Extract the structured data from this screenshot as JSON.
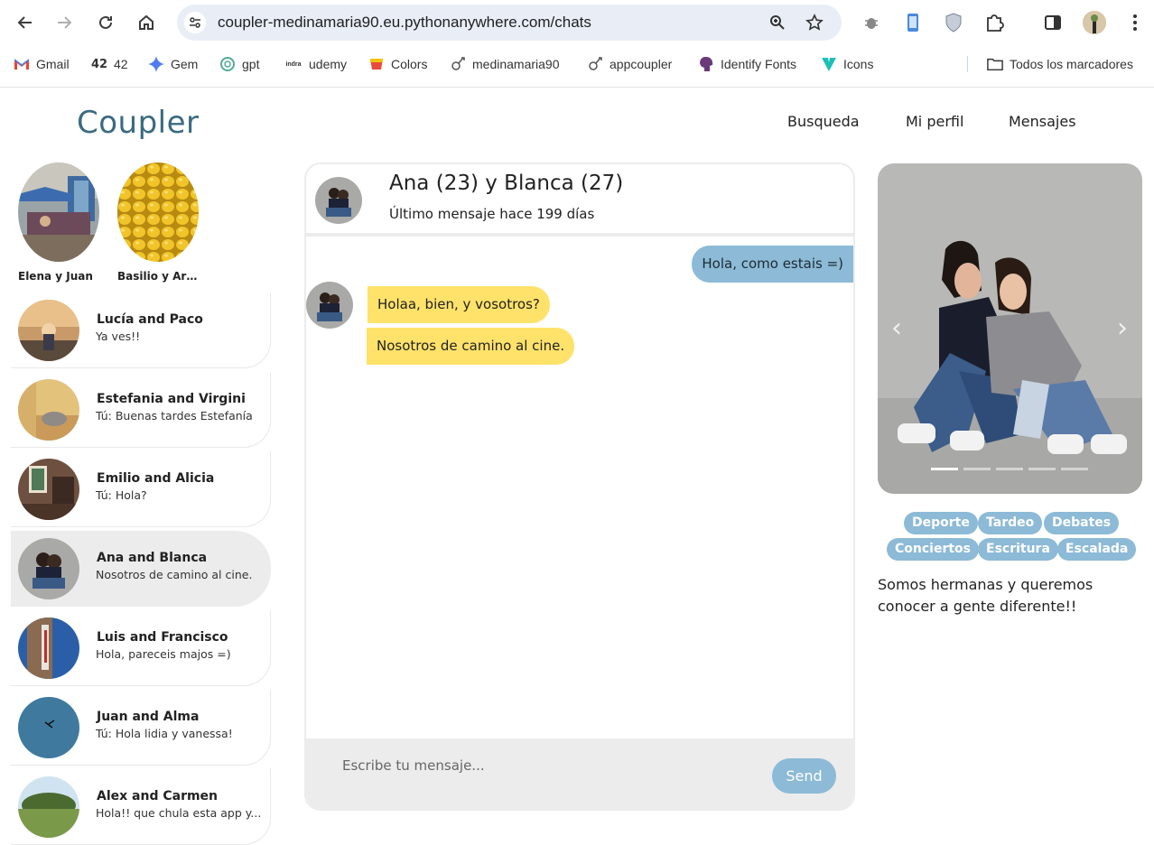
{
  "browser": {
    "url": "coupler-medinamaria90.eu.pythonanywhere.com/chats",
    "bookmarks": [
      "Gmail",
      "42",
      "Gem",
      "gpt",
      "udemy",
      "Colors",
      "medinamaria90",
      "appcoupler",
      "Identify Fonts",
      "Icons"
    ],
    "all_bookmarks": "Todos los marcadores"
  },
  "app": {
    "logo": "Coupler",
    "nav": [
      "Busqueda",
      "Mi perfil",
      "Mensajes"
    ]
  },
  "new_matches": [
    {
      "name": "Elena y Juan"
    },
    {
      "name": "Basilio y Artu..."
    }
  ],
  "chats": [
    {
      "name": "Lucía and Paco",
      "last": "Ya ves!!",
      "active": false
    },
    {
      "name": "Estefania and Virgini",
      "last": "Tú: Buenas tardes Estefanía",
      "active": false
    },
    {
      "name": "Emilio and Alicia",
      "last": "Tú: Hola?",
      "active": false
    },
    {
      "name": "Ana and Blanca",
      "last": "Nosotros de camino al cine.",
      "active": true
    },
    {
      "name": "Luis and Francisco",
      "last": "Hola, pareceis majos =)",
      "active": false
    },
    {
      "name": "Juan and Alma",
      "last": "Tú: Hola lidia y vanessa!",
      "active": false
    },
    {
      "name": "Alex and Carmen",
      "last": "Hola!! que chula esta app y...",
      "active": false
    }
  ],
  "conversation": {
    "title": "Ana (23) y Blanca (27)",
    "subtitle": "Último mensaje hace 199 días",
    "messages": [
      {
        "from": "me",
        "text": "Hola, como estais =)"
      },
      {
        "from": "them",
        "text": "Holaa, bien, y vosotros?"
      },
      {
        "from": "them",
        "text": "Nosotros de camino al cine."
      }
    ],
    "input_placeholder": "Escribe tu mensaje...",
    "send_label": "Send"
  },
  "profile": {
    "photo_count": 5,
    "active_photo": 1,
    "tags": [
      "Deporte",
      "Tardeo",
      "Debates",
      "Conciertos",
      "Escritura",
      "Escalada"
    ],
    "bio": "Somos hermanas y queremos conocer a gente diferente!!"
  },
  "colors": {
    "brand": "#3a6b80",
    "accent": "#8cbad7",
    "incoming_bubble": "#ffe26a",
    "panel_grey": "#ececec"
  }
}
